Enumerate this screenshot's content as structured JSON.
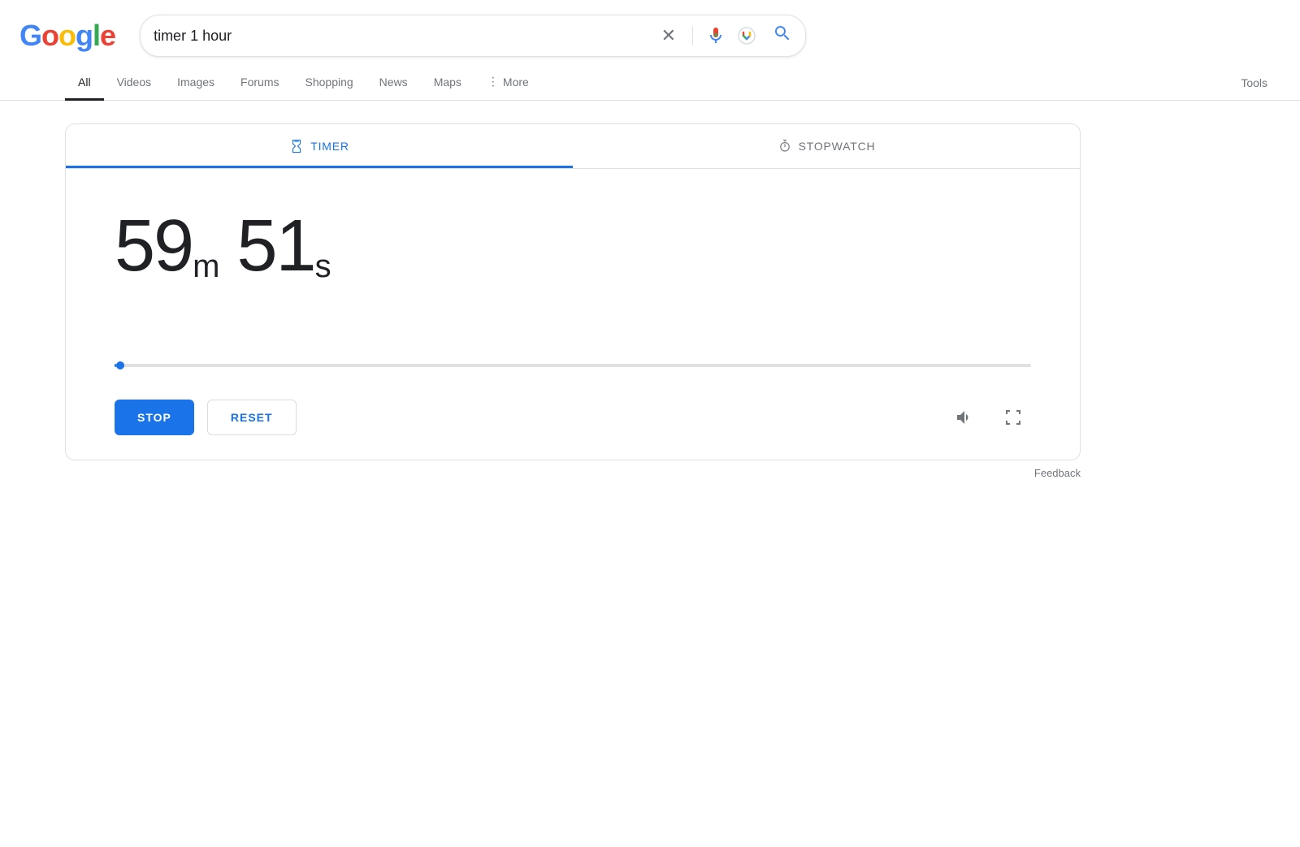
{
  "header": {
    "logo": "Google",
    "logo_letters": [
      {
        "char": "G",
        "color": "blue"
      },
      {
        "char": "o",
        "color": "red"
      },
      {
        "char": "o",
        "color": "yellow"
      },
      {
        "char": "g",
        "color": "blue"
      },
      {
        "char": "l",
        "color": "green"
      },
      {
        "char": "e",
        "color": "red"
      }
    ],
    "search_value": "timer 1 hour",
    "clear_label": "×"
  },
  "nav": {
    "tabs": [
      {
        "label": "All",
        "active": true
      },
      {
        "label": "Videos",
        "active": false
      },
      {
        "label": "Images",
        "active": false
      },
      {
        "label": "Forums",
        "active": false
      },
      {
        "label": "Shopping",
        "active": false
      },
      {
        "label": "News",
        "active": false
      },
      {
        "label": "Maps",
        "active": false
      },
      {
        "label": "More",
        "active": false,
        "has_dots": true
      }
    ],
    "tools_label": "Tools"
  },
  "timer_card": {
    "tab_timer_label": "TIMER",
    "tab_stopwatch_label": "STOPWATCH",
    "minutes": "59",
    "minutes_unit": "m",
    "seconds": "51",
    "seconds_unit": "s",
    "progress_percent": 0.14,
    "btn_stop": "STOP",
    "btn_reset": "RESET",
    "feedback_label": "Feedback"
  }
}
